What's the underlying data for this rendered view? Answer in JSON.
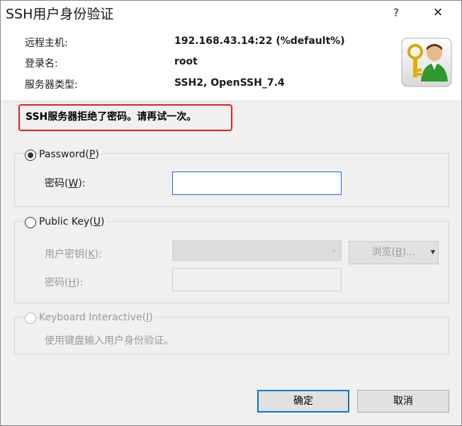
{
  "window": {
    "title": "SSH用户身份验证",
    "help_label": "?",
    "close_label": "✕"
  },
  "info": {
    "rows": [
      {
        "label": "远程主机:",
        "value": "192.168.43.14:22 (%default%)"
      },
      {
        "label": "登录名:",
        "value": "root"
      },
      {
        "label": "服务器类型:",
        "value": "SSH2, OpenSSH_7.4"
      }
    ]
  },
  "error_message": "SSH服务器拒绝了密码。请再试一次。",
  "password_group": {
    "label_main": "Password(",
    "label_key": "P",
    "label_end": ")",
    "field_label_main": "密码(",
    "field_label_key": "W",
    "field_label_end": "):",
    "field_value": "",
    "selected": true
  },
  "publickey_group": {
    "label_main": "Public Key(",
    "label_key": "U",
    "label_end": ")",
    "userkey_label_main": "用户密钥(",
    "userkey_label_key": "K",
    "userkey_label_end": "):",
    "userkey_value": "",
    "browse_label_main": "浏览(",
    "browse_label_key": "B",
    "browse_label_end": ")...",
    "passphrase_label_main": "密码(",
    "passphrase_label_key": "H",
    "passphrase_label_end": "):",
    "passphrase_value": ""
  },
  "keyboard_group": {
    "label_main": "Keyboard Interactive(",
    "label_key": "I",
    "label_end": ")",
    "description": "使用键盘输入用户身份验证。"
  },
  "buttons": {
    "ok_label": "确定",
    "cancel_label": "取消"
  },
  "colors": {
    "highlight_border": "#e02020",
    "focus_border": "#1a6fd1",
    "default_button_border": "#0078d7"
  }
}
